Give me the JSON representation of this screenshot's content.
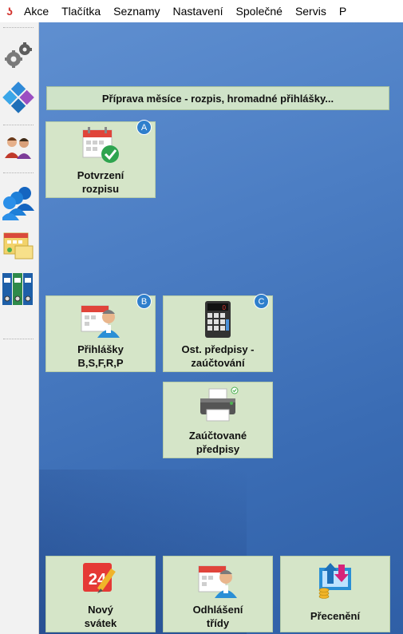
{
  "menu": {
    "items": [
      "Akce",
      "Tlačítka",
      "Seznamy",
      "Nastavení",
      "Společné",
      "Servis",
      "P"
    ]
  },
  "toolbar": {
    "icons": [
      "gears-icon",
      "puzzle-icon",
      "users-icon",
      "people-group-icon",
      "calendar-icon",
      "binders-icon"
    ]
  },
  "section": {
    "title": "Příprava měsíce - rozpis, hromadné přihlášky..."
  },
  "tiles": {
    "potvrzeni": {
      "label": "Potvrzení\nrozpisu",
      "badge": "A"
    },
    "prihlasky": {
      "label": "Přihlášky\nB,S,F,R,P",
      "badge": "B"
    },
    "ost_predpisy": {
      "label": "Ost. předpisy -\nzaúčtování",
      "badge": "C",
      "display": "0"
    },
    "zauctovane": {
      "label": "Zaúčtované\npředpisy"
    },
    "novy_svatek": {
      "label": "Nový\nsvátek",
      "calendar_number": "24"
    },
    "odhlaseni": {
      "label": "Odhlášení\ntřídy"
    },
    "preceneni": {
      "label": "Přecenění"
    }
  },
  "colors": {
    "desktop": "#4c7ec4",
    "tile": "#d5e5c8",
    "badge": "#2f7fcc",
    "logo": "#d3342f"
  }
}
